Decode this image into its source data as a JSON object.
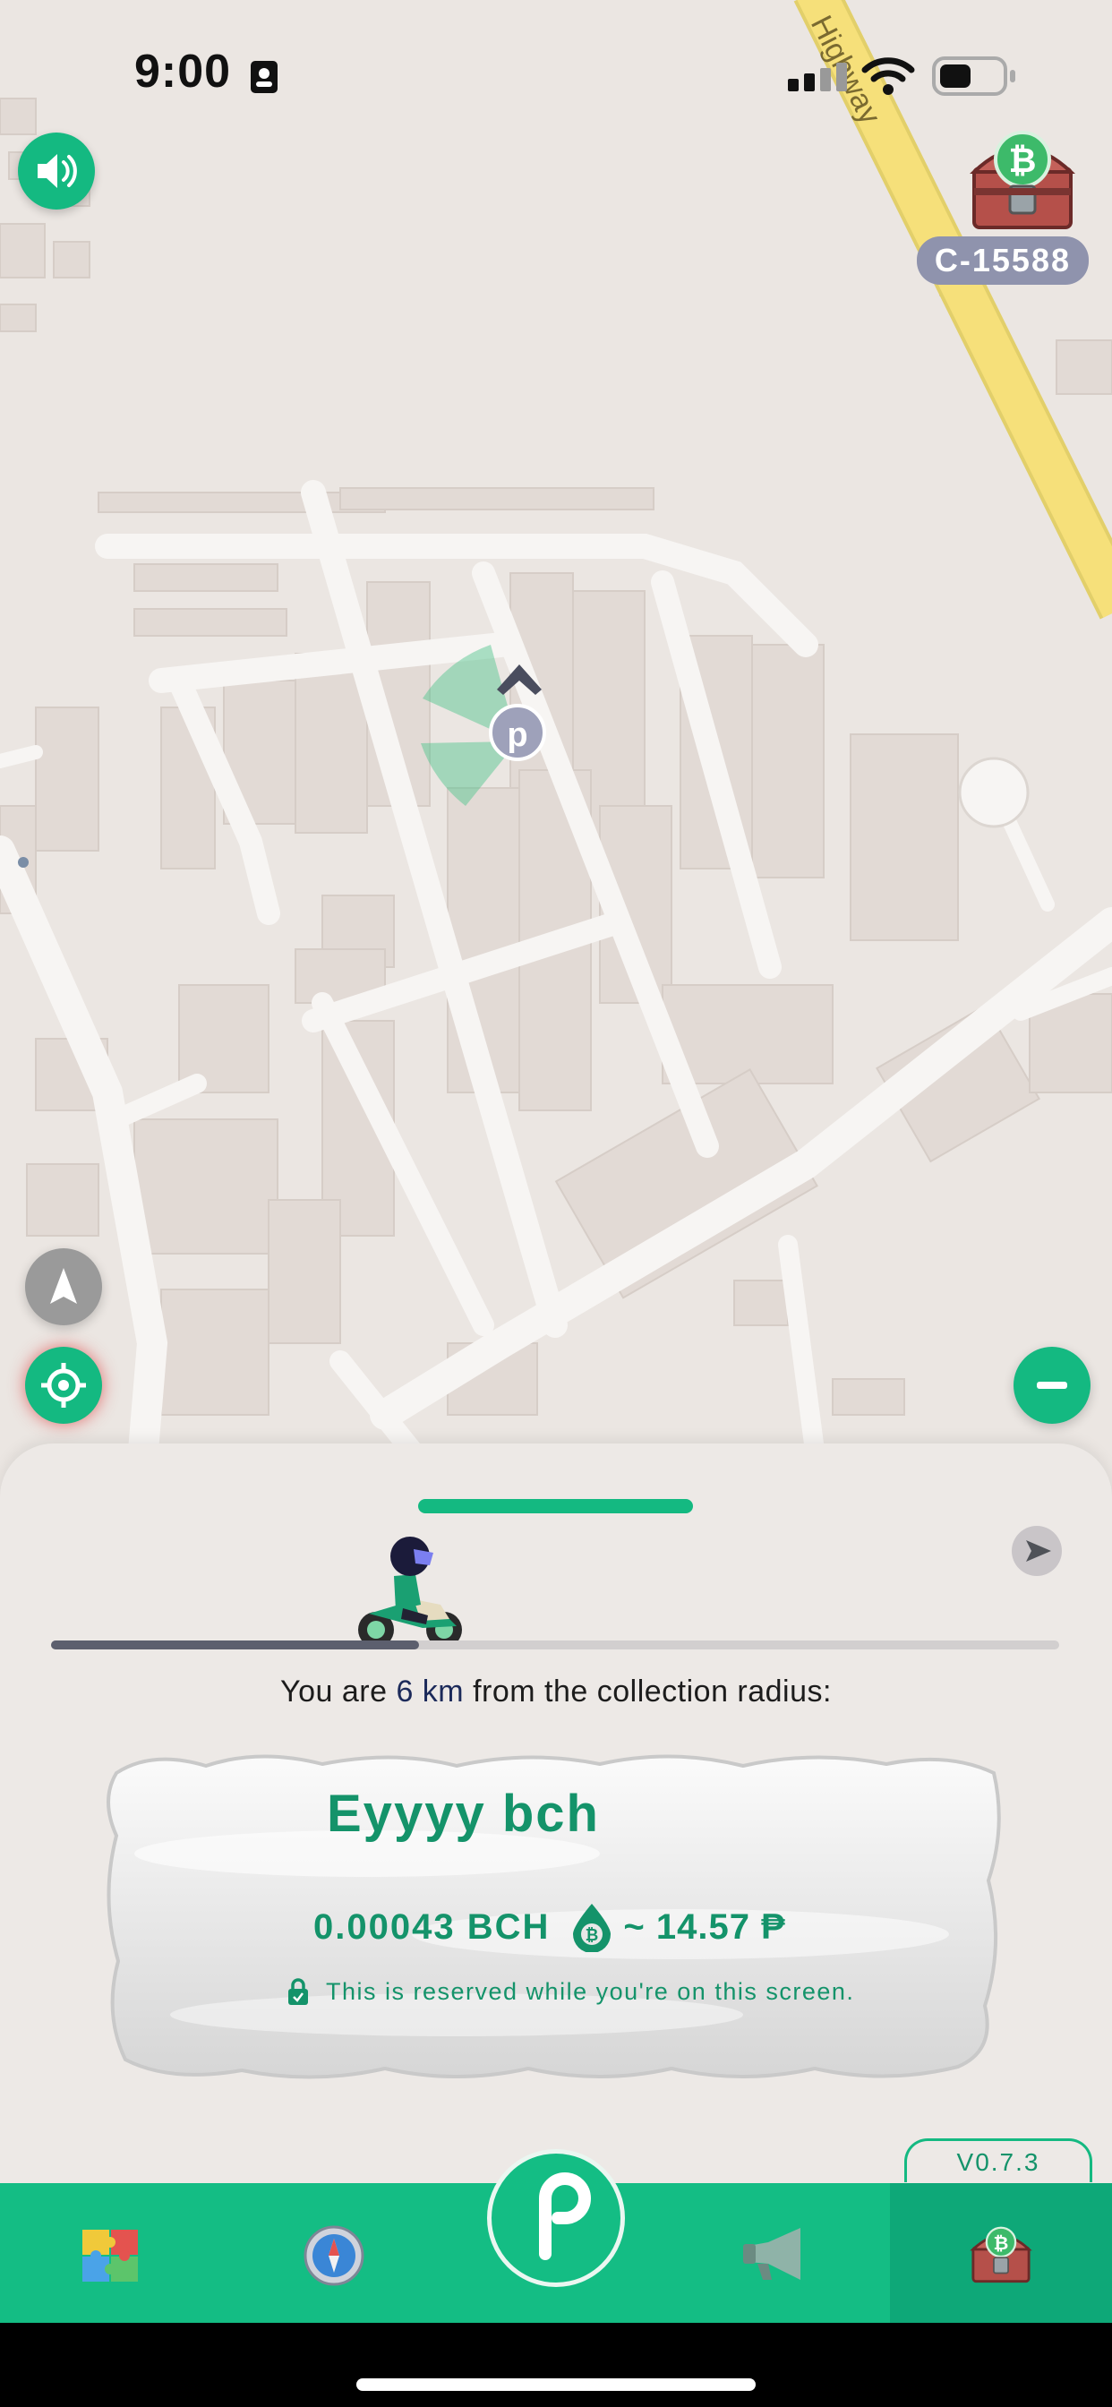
{
  "status_bar": {
    "time": "9:00"
  },
  "map": {
    "road_label": "Highway"
  },
  "chest": {
    "code": "C-15588"
  },
  "sheet": {
    "distance_prefix": "You are ",
    "distance_value": "6 km",
    "distance_suffix": " from the collection radius:",
    "progress": 0.365
  },
  "reward": {
    "title": "Eyyyy bch",
    "amount": "0.00043 BCH",
    "fiat": "~ 14.57 ₱",
    "reserved_note": "This is reserved while you're on this screen."
  },
  "version": "V0.7.3",
  "tabs": [
    {
      "icon": "puzzle-icon"
    },
    {
      "icon": "compass-icon"
    },
    {
      "icon": "paytaca-p-icon"
    },
    {
      "icon": "megaphone-icon"
    },
    {
      "icon": "treasure-chest-icon"
    }
  ],
  "colors": {
    "accent": "#14bd84",
    "accent_dark": "#14936a",
    "road_yellow": "#f5e27a",
    "badge_gray": "#8f93ad"
  }
}
